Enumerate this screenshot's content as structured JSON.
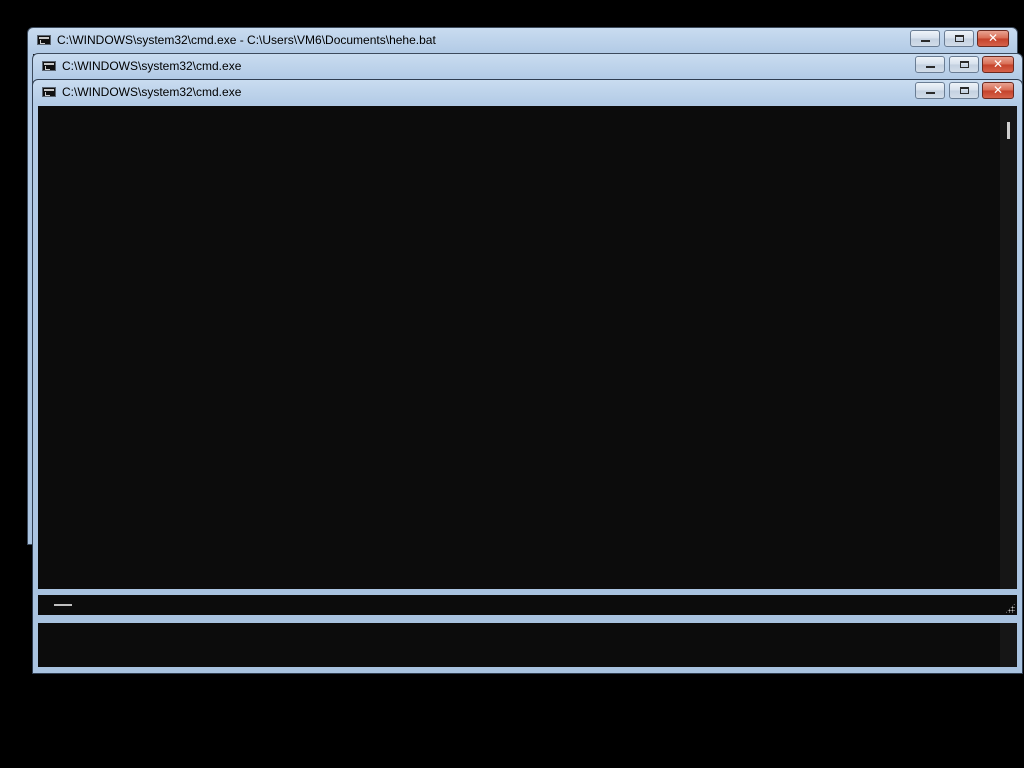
{
  "windows": [
    {
      "title": "C:\\WINDOWS\\system32\\cmd.exe - C:\\Users\\VM6\\Documents\\hehe.bat",
      "icon": "cmd-icon",
      "state": "inactive"
    },
    {
      "title": "C:\\WINDOWS\\system32\\cmd.exe",
      "icon": "cmd-icon",
      "state": "inactive"
    },
    {
      "title": "C:\\WINDOWS\\system32\\cmd.exe",
      "icon": "cmd-icon",
      "state": "active"
    }
  ],
  "controls": {
    "minimize_icon": "minimize-icon",
    "maximize_icon": "maximize-icon",
    "close_icon": "close-icon",
    "close_glyph": "✕"
  },
  "colors": {
    "console_background": "#0c0c0c",
    "close_button": "#c4412a",
    "title_bar": "#b3cbe6"
  }
}
